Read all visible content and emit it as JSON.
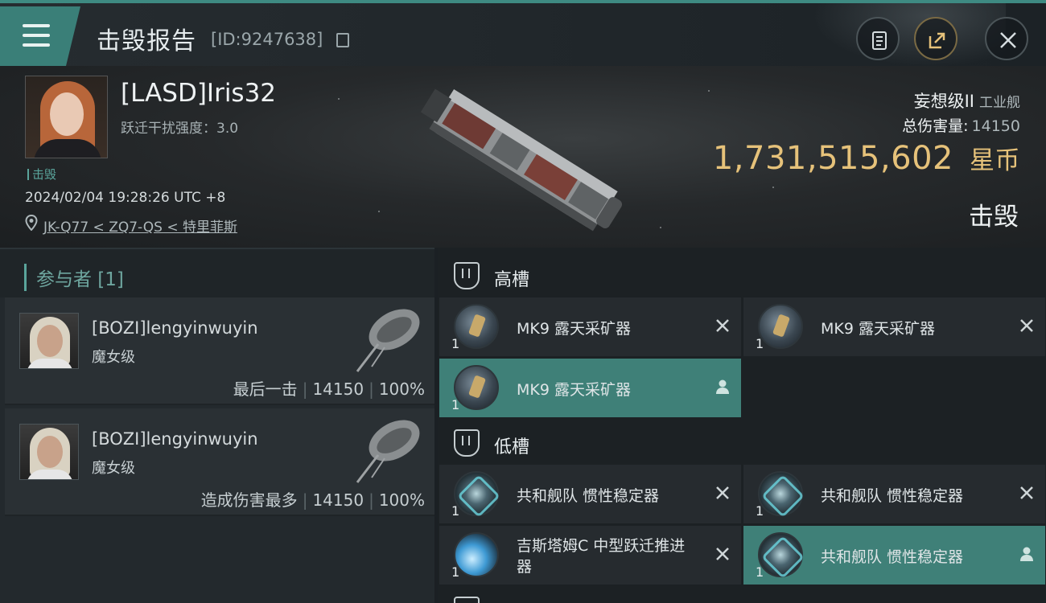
{
  "header": {
    "title": "击毁报告",
    "report_id": "[ID:9247638]"
  },
  "victim": {
    "name": "[LASD]Iris32",
    "warp_disruption": "跃迁干扰强度：3.0",
    "tag": "击毁",
    "datetime": "2024/02/04 19:28:26 UTC +8",
    "location": "JK-Q77 < ZQ7-QS < 特里菲斯"
  },
  "ship": {
    "name": "妄想级II",
    "class": "工业舰",
    "total_damage_label": "总伤害量:",
    "total_damage": "14150",
    "value": "1,731,515,602",
    "value_unit": "星币",
    "status": "击毁"
  },
  "participants": {
    "label": "参与者 [1]",
    "items": [
      {
        "name": "[BOZI]lengyinwuyin",
        "ship": "魔女级",
        "tag": "最后一击",
        "damage": "14150",
        "percent": "100%"
      },
      {
        "name": "[BOZI]lengyinwuyin",
        "ship": "魔女级",
        "tag": "造成伤害最多",
        "damage": "14150",
        "percent": "100%"
      }
    ]
  },
  "slots": {
    "high": {
      "label": "高槽",
      "modules": [
        {
          "name": "MK9 露天采矿器",
          "qty": "1",
          "status": "destroyed"
        },
        {
          "name": "MK9 露天采矿器",
          "qty": "1",
          "status": "destroyed"
        },
        {
          "name": "MK9 露天采矿器",
          "qty": "1",
          "status": "dropped"
        }
      ]
    },
    "low": {
      "label": "低槽",
      "modules": [
        {
          "name": "共和舰队 惯性稳定器",
          "qty": "1",
          "status": "destroyed"
        },
        {
          "name": "共和舰队 惯性稳定器",
          "qty": "1",
          "status": "destroyed"
        },
        {
          "name": "吉斯塔姆C 中型跃迁推进器",
          "qty": "1",
          "status": "destroyed"
        },
        {
          "name": "共和舰队 惯性稳定器",
          "qty": "1",
          "status": "dropped"
        }
      ]
    }
  },
  "icons": {
    "menu": "menu-icon",
    "clipboard": "clipboard-icon",
    "share": "share-icon",
    "close": "close-icon",
    "location": "location-pin-icon",
    "destroyed": "x-icon",
    "dropped": "person-icon",
    "slot": "slot-shield-icon"
  },
  "colors": {
    "accent": "#3e8a82",
    "isk": "#e6c27a",
    "dropped_bg": "#3f8078"
  }
}
